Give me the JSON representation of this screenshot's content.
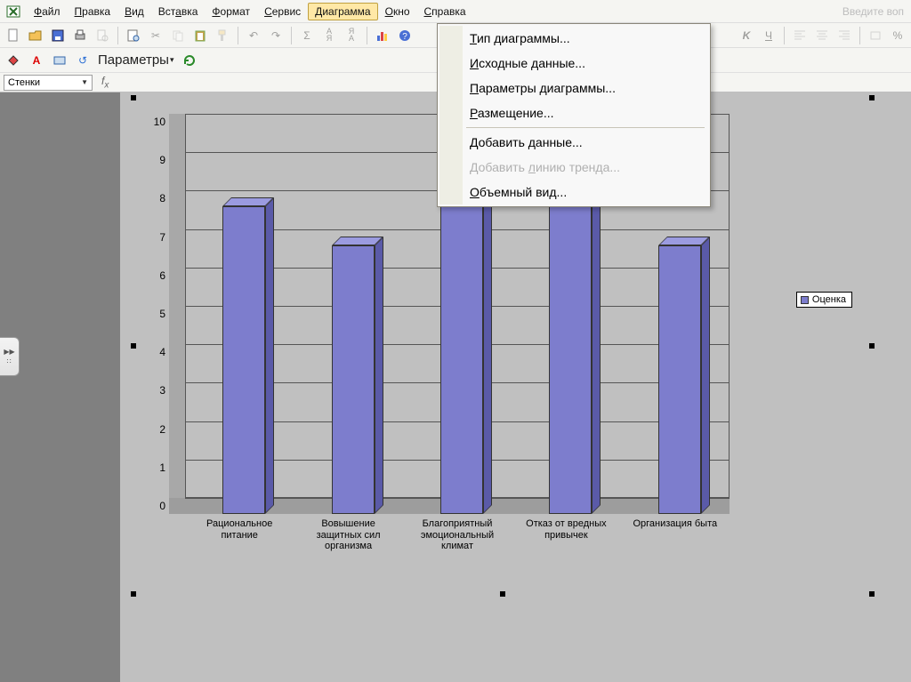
{
  "menubar": {
    "items": [
      {
        "label": "Файл",
        "u": 0
      },
      {
        "label": "Правка",
        "u": 0
      },
      {
        "label": "Вид",
        "u": 0
      },
      {
        "label": "Вставка",
        "u": 3
      },
      {
        "label": "Формат",
        "u": 0
      },
      {
        "label": "Сервис",
        "u": 0
      },
      {
        "label": "Диаграмма",
        "u": 0
      },
      {
        "label": "Окно",
        "u": 0
      },
      {
        "label": "Справка",
        "u": 0
      }
    ],
    "help_placeholder": "Введите воп"
  },
  "toolbar2": {
    "params_label": "Параметры"
  },
  "formula_bar": {
    "name_box": "Стенки"
  },
  "dropdown": {
    "items": [
      {
        "label": "Тип диаграммы...",
        "u": 0,
        "disabled": false
      },
      {
        "label": "Исходные данные...",
        "u": 0,
        "disabled": false
      },
      {
        "label": "Параметры диаграммы...",
        "u": 0,
        "disabled": false
      },
      {
        "label": "Размещение...",
        "u": 0,
        "disabled": false
      },
      {
        "sep": true
      },
      {
        "label": "Добавить данные...",
        "u": 0,
        "disabled": false
      },
      {
        "label": "Добавить линию тренда...",
        "u": 9,
        "disabled": true
      },
      {
        "label": "Объемный вид...",
        "u": 0,
        "disabled": false
      }
    ]
  },
  "chart_data": {
    "type": "bar",
    "categories": [
      "Рациональное питание",
      "Вовышение защитных сил организма",
      "Благоприятный эмоциональный климат",
      "Отказ от вредных привычек",
      "Организация быта"
    ],
    "values": [
      8,
      7,
      10,
      10,
      7
    ],
    "ylim": [
      0,
      10
    ],
    "yticks": [
      0,
      1,
      2,
      3,
      4,
      5,
      6,
      7,
      8,
      9,
      10
    ],
    "legend": "Оценка",
    "title": "",
    "xlabel": "",
    "ylabel": ""
  }
}
